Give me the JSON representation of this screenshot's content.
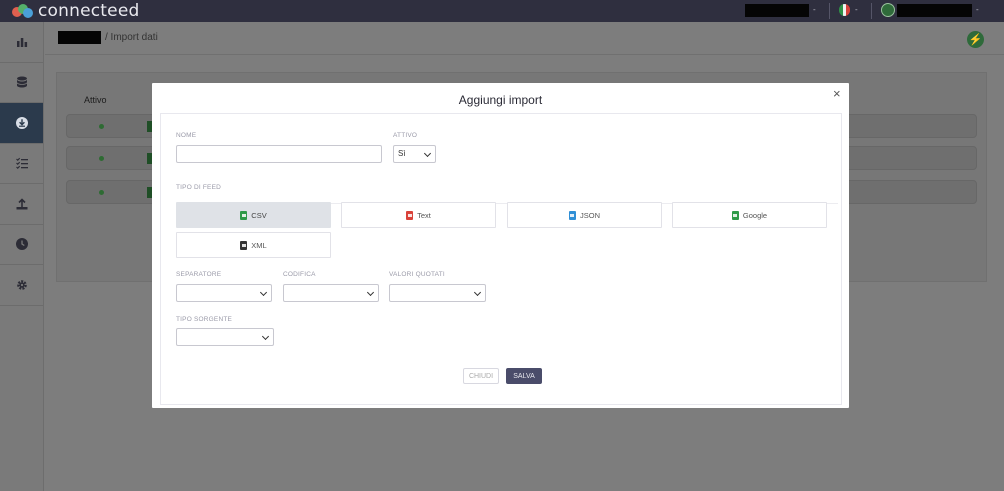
{
  "app": {
    "brand": "connecteed"
  },
  "topbar": {
    "user_caret": "-",
    "lang_caret": "-",
    "account_caret": "-"
  },
  "sidebar": {
    "items": [
      {
        "icon": "bar-chart-icon"
      },
      {
        "icon": "database-icon"
      },
      {
        "icon": "download-icon",
        "active": true
      },
      {
        "icon": "checklist-icon"
      },
      {
        "icon": "upload-icon"
      },
      {
        "icon": "clock-icon"
      },
      {
        "icon": "gear-icon"
      }
    ]
  },
  "breadcrumb": {
    "current": "/ Import dati"
  },
  "table": {
    "header_attivo": "Attivo",
    "rows": 3
  },
  "modal": {
    "title": "Aggiungi import",
    "close": "×",
    "fields": {
      "nome_label": "NOME",
      "nome_value": "",
      "attivo_label": "ATTIVO",
      "attivo_value": "Sì",
      "tipo_feed_label": "TIPO DI FEED",
      "separatore_label": "SEPARATORE",
      "codifica_label": "CODIFICA",
      "valori_quotati_label": "VALORI QUOTATI",
      "tipo_sorgente_label": "TIPO SORGENTE"
    },
    "feed_types": [
      {
        "label": "CSV",
        "icon": "csv-file-icon",
        "color": "#2e9a47",
        "selected": true
      },
      {
        "label": "Text",
        "icon": "text-file-icon",
        "color": "#d9423a",
        "selected": false
      },
      {
        "label": "JSON",
        "icon": "json-file-icon",
        "color": "#2f8fd6",
        "selected": false
      },
      {
        "label": "Google",
        "icon": "google-sheets-icon",
        "color": "#2e9a47",
        "selected": false
      },
      {
        "label": "XML",
        "icon": "xml-file-icon",
        "color": "#333333",
        "selected": false
      }
    ],
    "buttons": {
      "close_label": "CHIUDI",
      "save_label": "SALVA"
    }
  },
  "colors": {
    "accent": "#4a4c6a",
    "topbar": "#2f2f3f",
    "sidebar_active": "#2b3a4c"
  }
}
